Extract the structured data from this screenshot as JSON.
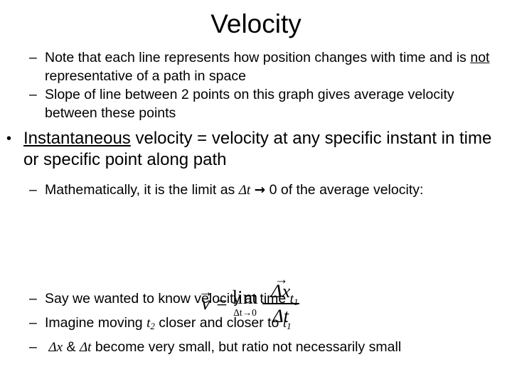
{
  "slide": {
    "title": "Velocity",
    "bullets": [
      {
        "level": 2,
        "marker": "–",
        "segments": [
          {
            "text": "Note that each line represents how position changes with time and is ",
            "style": "plain"
          },
          {
            "text": "not",
            "style": "underline"
          },
          {
            "text": " representative of a path in space",
            "style": "plain"
          }
        ],
        "plain_text": "Note that each line represents how position changes with time and is not representative of a path in space"
      },
      {
        "level": 2,
        "marker": "–",
        "segments": [
          {
            "text": "Slope of line between 2 points on this graph gives average velocity between these points",
            "style": "plain"
          }
        ],
        "plain_text": "Slope of line between 2 points on this graph gives average velocity between these points"
      },
      {
        "level": 1,
        "marker": "•",
        "segments": [
          {
            "text": "Instantaneous",
            "style": "underline"
          },
          {
            "text": " velocity = velocity at any specific instant in time or specific point along path",
            "style": "plain"
          }
        ],
        "plain_text": "Instantaneous velocity = velocity at any specific instant in time or specific point along path"
      },
      {
        "level": 2,
        "marker": "–",
        "segments": [
          {
            "text": "Mathematically, it is the limit as ",
            "style": "plain"
          },
          {
            "text": "Δt",
            "style": "math"
          },
          {
            "text": " → 0 of the average velocity:",
            "style": "plain"
          }
        ],
        "plain_text": "Mathematically, it is the limit as Δt → 0 of the average velocity:"
      },
      {
        "level": 2,
        "marker": "–",
        "segments": [
          {
            "text": "Say we wanted to know velocity at time ",
            "style": "plain"
          },
          {
            "text": "t1",
            "style": "math-sub"
          }
        ],
        "plain_text": "Say we wanted to know velocity at time t1"
      },
      {
        "level": 2,
        "marker": "–",
        "segments": [
          {
            "text": "Imagine moving ",
            "style": "plain"
          },
          {
            "text": "t2",
            "style": "math-sub"
          },
          {
            "text": " closer and closer to ",
            "style": "plain"
          },
          {
            "text": "t1",
            "style": "math-sub"
          }
        ],
        "plain_text": "Imagine moving t2 closer and closer to t1"
      },
      {
        "level": 2,
        "marker": "–",
        "segments": [
          {
            "text": " Δx",
            "style": "math"
          },
          {
            "text": " & ",
            "style": "plain"
          },
          {
            "text": "Δt",
            "style": "math"
          },
          {
            "text": " become very small, but ratio not necessarily small",
            "style": "plain"
          }
        ],
        "plain_text": " Δx & Δt become very small, but ratio not necessarily small"
      }
    ],
    "text_lines": {
      "b1_part1": "Note that each line represents how position changes with time and is ",
      "b1_not": "not",
      "b1_part2": " representative of a path in space",
      "b2": "Slope of line between 2 points on this graph gives average velocity between these points",
      "b3_instantaneous": "Instantaneous",
      "b3_rest": " velocity = velocity at any specific instant in time or specific point along path",
      "b4_part1": "Mathematically, it is the limit as ",
      "b4_delta_t": "Δt",
      "b4_arrow": "→",
      "b4_part2": " 0 of the average velocity:",
      "b5_part1": "Say we wanted to know velocity at time ",
      "b5_t": "t",
      "b5_t_sub": "1",
      "b6_part1": "Imagine moving ",
      "b6_t_a": "t",
      "b6_t_a_sub": "2",
      "b6_part2": " closer and closer to ",
      "b6_t_b": "t",
      "b6_t_b_sub": "1",
      "b7_dx": "Δx",
      "b7_amp": " & ",
      "b7_dt": "Δt",
      "b7_rest": " become very small, but ratio not necessarily small"
    },
    "equation": {
      "description": "v vector equals limit as delta t approaches 0 of delta x vector over delta t",
      "lhs_symbol": "v",
      "vector_arrow": "→",
      "equals": "=",
      "lim": "lim",
      "lim_subscript": "Δt→0",
      "numerator": "Δx",
      "denominator": "Δt"
    },
    "colors": {
      "background": "#ffffff",
      "text": "#000000"
    }
  }
}
